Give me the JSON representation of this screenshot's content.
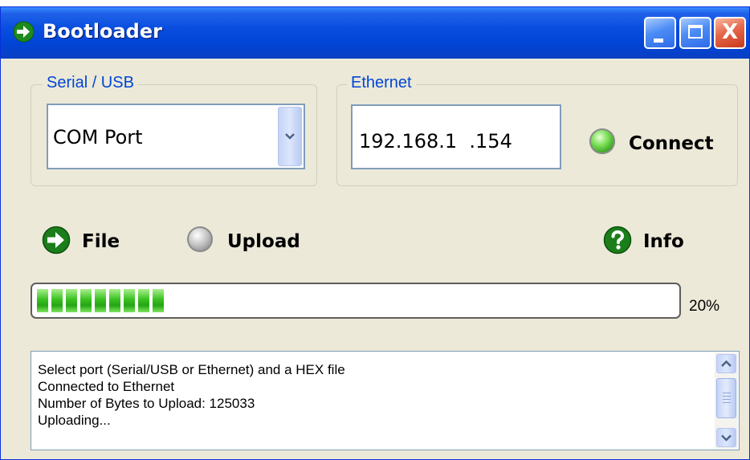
{
  "window": {
    "title": "Bootloader",
    "controls": {
      "minimize_icon": "minimize-icon",
      "maximize_icon": "maximize-icon",
      "close_glyph": "X"
    }
  },
  "serial": {
    "group_label": "Serial / USB",
    "port_value": "COM Port"
  },
  "ethernet": {
    "group_label": "Ethernet",
    "ip_value": "192.168.1  .154",
    "connect_label": "Connect",
    "status_led": "green"
  },
  "actions": {
    "file_label": "File",
    "upload_label": "Upload",
    "upload_led": "gray",
    "info_label": "Info"
  },
  "progress": {
    "value_fraction": 0.2,
    "label": "20%",
    "color": "#2DB318"
  },
  "log": {
    "lines": [
      "Select port (Serial/USB or Ethernet) and a HEX file",
      "Connected to Ethernet",
      "Number of Bytes to Upload: 125033",
      "Uploading..."
    ]
  },
  "colors": {
    "titlebar": "#0A4EE0",
    "window_bg": "#ECE9D8",
    "group_label": "#0046D5"
  }
}
